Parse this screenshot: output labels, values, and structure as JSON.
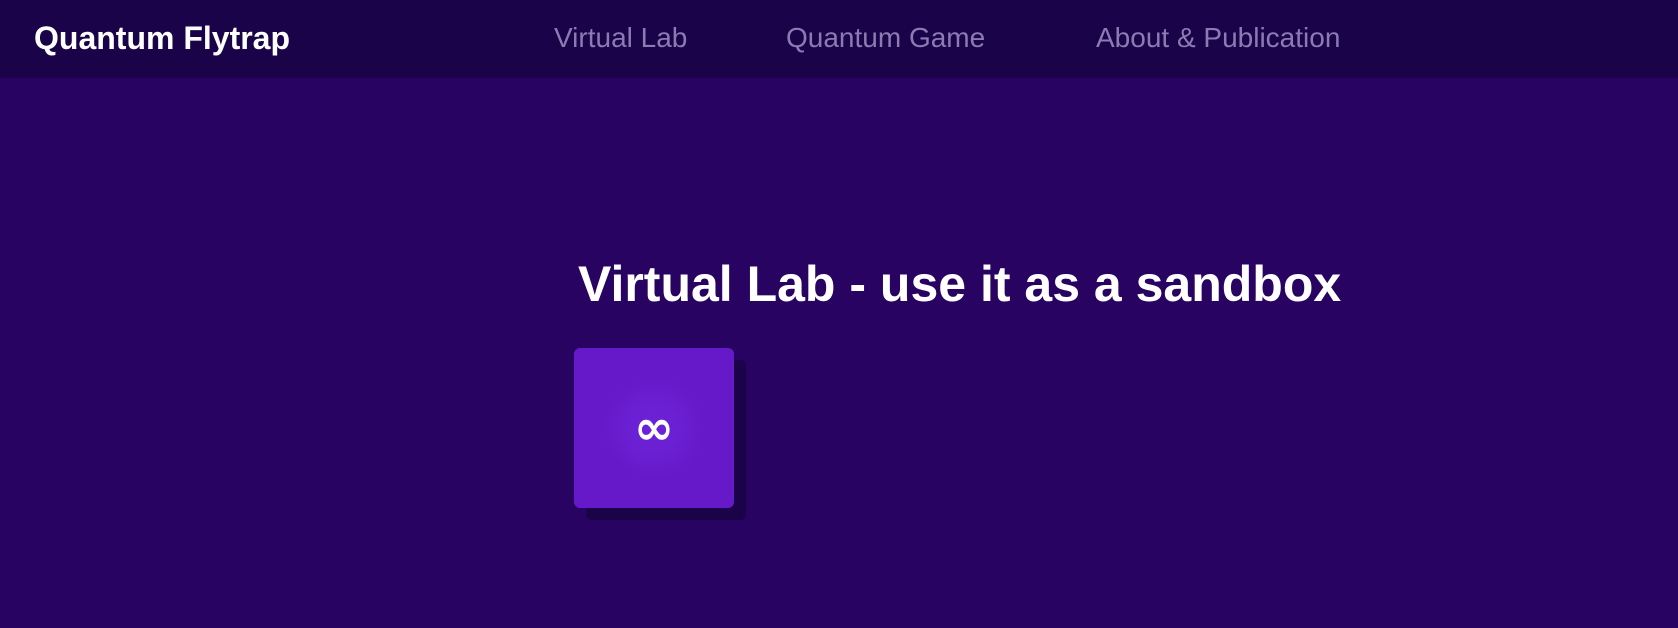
{
  "navbar": {
    "brand": "Quantum Flytrap",
    "links": [
      {
        "label": "Virtual Lab"
      },
      {
        "label": "Quantum Game"
      },
      {
        "label": "About & Publication"
      }
    ]
  },
  "main": {
    "heading": "Virtual Lab - use it as a sandbox",
    "tiles": [
      {
        "icon": "infinity-icon",
        "symbol": "∞"
      }
    ]
  },
  "colors": {
    "background": "#280361",
    "navbar": "#1a0349",
    "nav_link": "#8c7bb3",
    "tile": "#6519c8",
    "text": "#ffffff"
  }
}
